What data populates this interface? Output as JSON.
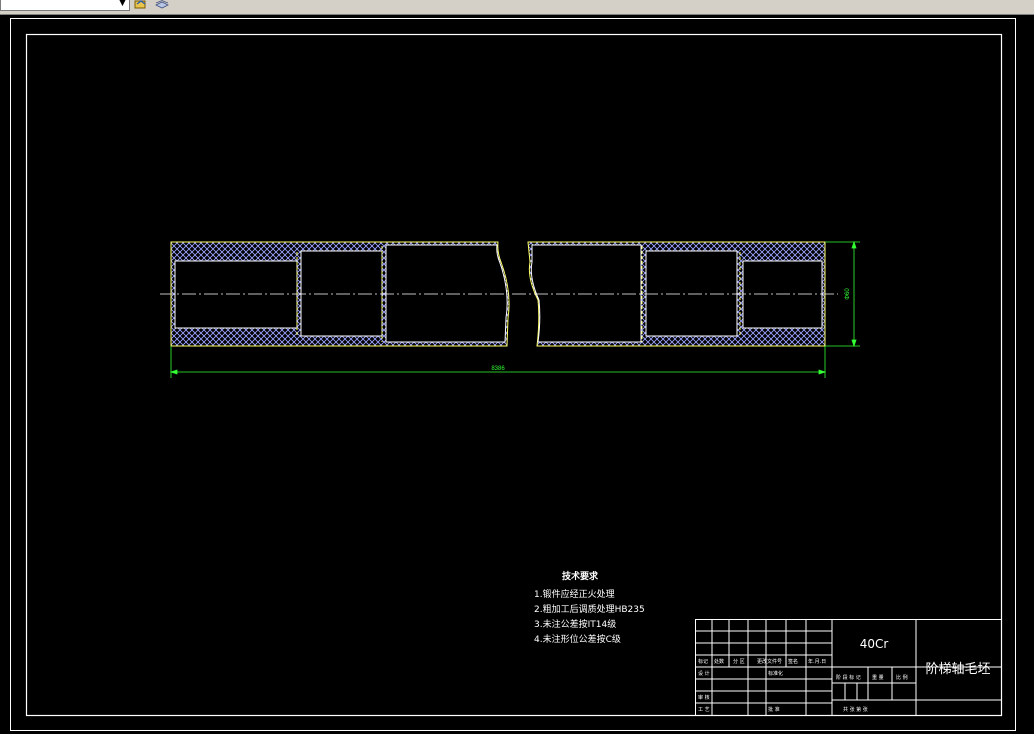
{
  "toolbar": {
    "icons": [
      "layer-tool-icon",
      "layer-stack-icon"
    ]
  },
  "drawing": {
    "dimensions": {
      "overall_length": "8386",
      "diameter": "Φ60"
    },
    "tech_requirements": {
      "title": "技术要求",
      "items": [
        "1.锻件应经正火处理",
        "2.粗加工后调质处理HB235",
        "3.未注公差按IT14级",
        "4.未注形位公差按C级"
      ]
    },
    "title_block": {
      "material": "40Cr",
      "part_name": "阶梯轴毛坯",
      "labels": {
        "mark": "标记",
        "count": "处数",
        "zone": "分 区",
        "change_doc": "更改文件号",
        "signature": "签名",
        "date": "年.月.日",
        "design": "设 计",
        "standardize": "标准化",
        "review": "审 核",
        "process": "工 艺",
        "approve": "批 准",
        "stage_mark": "阶 段 标 记",
        "weight": "重 量",
        "scale": "比 例",
        "sheets": "共   张   第   张"
      }
    },
    "colors": {
      "background": "#000000",
      "outline": "#ffffff",
      "shaft_outline": "#ffff66",
      "hatch": "#9ca3ff",
      "dimension": "#33ff33"
    }
  }
}
